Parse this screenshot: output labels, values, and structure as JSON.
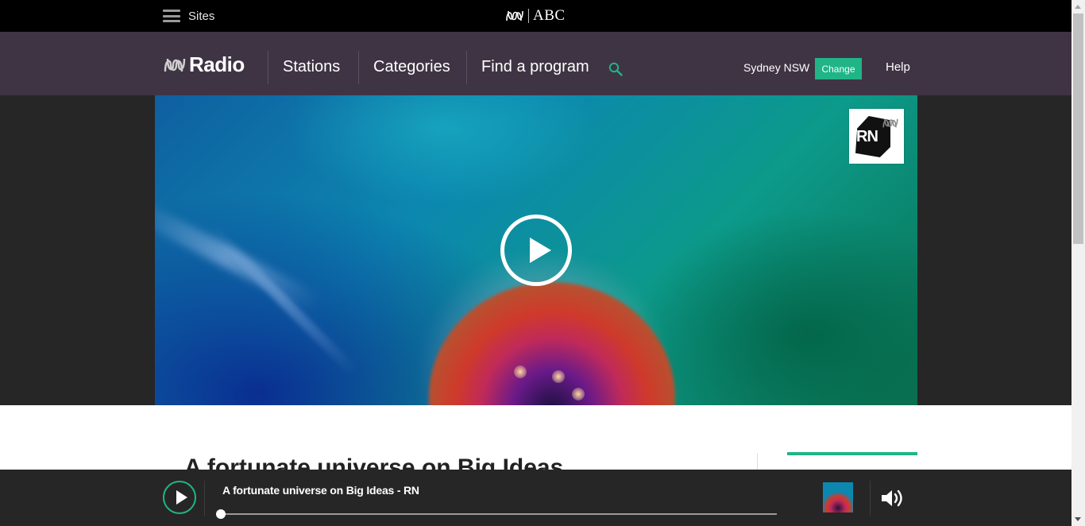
{
  "topbar": {
    "sites_label": "Sites",
    "abc_wordmark": "ABC",
    "icons": [
      "hamburger-icon",
      "abc-lissajous-icon"
    ]
  },
  "nav": {
    "logo_text": "Radio",
    "items": [
      "Stations",
      "Categories",
      "Find a program"
    ],
    "location": "Sydney NSW",
    "change_label": "Change",
    "help_label": "Help",
    "search_icon": "search-icon"
  },
  "hero": {
    "badge_text": "RN",
    "play_icon": "play-icon"
  },
  "content": {
    "headline": "A fortunate universe on Big Ideas"
  },
  "player": {
    "now_playing": "A fortunate universe on Big Ideas - RN",
    "progress": 0,
    "volume_icon": "volume-icon"
  },
  "colors": {
    "accent": "#20b487",
    "nav_bg": "#3f3444",
    "topbar_bg": "#000000",
    "player_bg": "#262626"
  }
}
